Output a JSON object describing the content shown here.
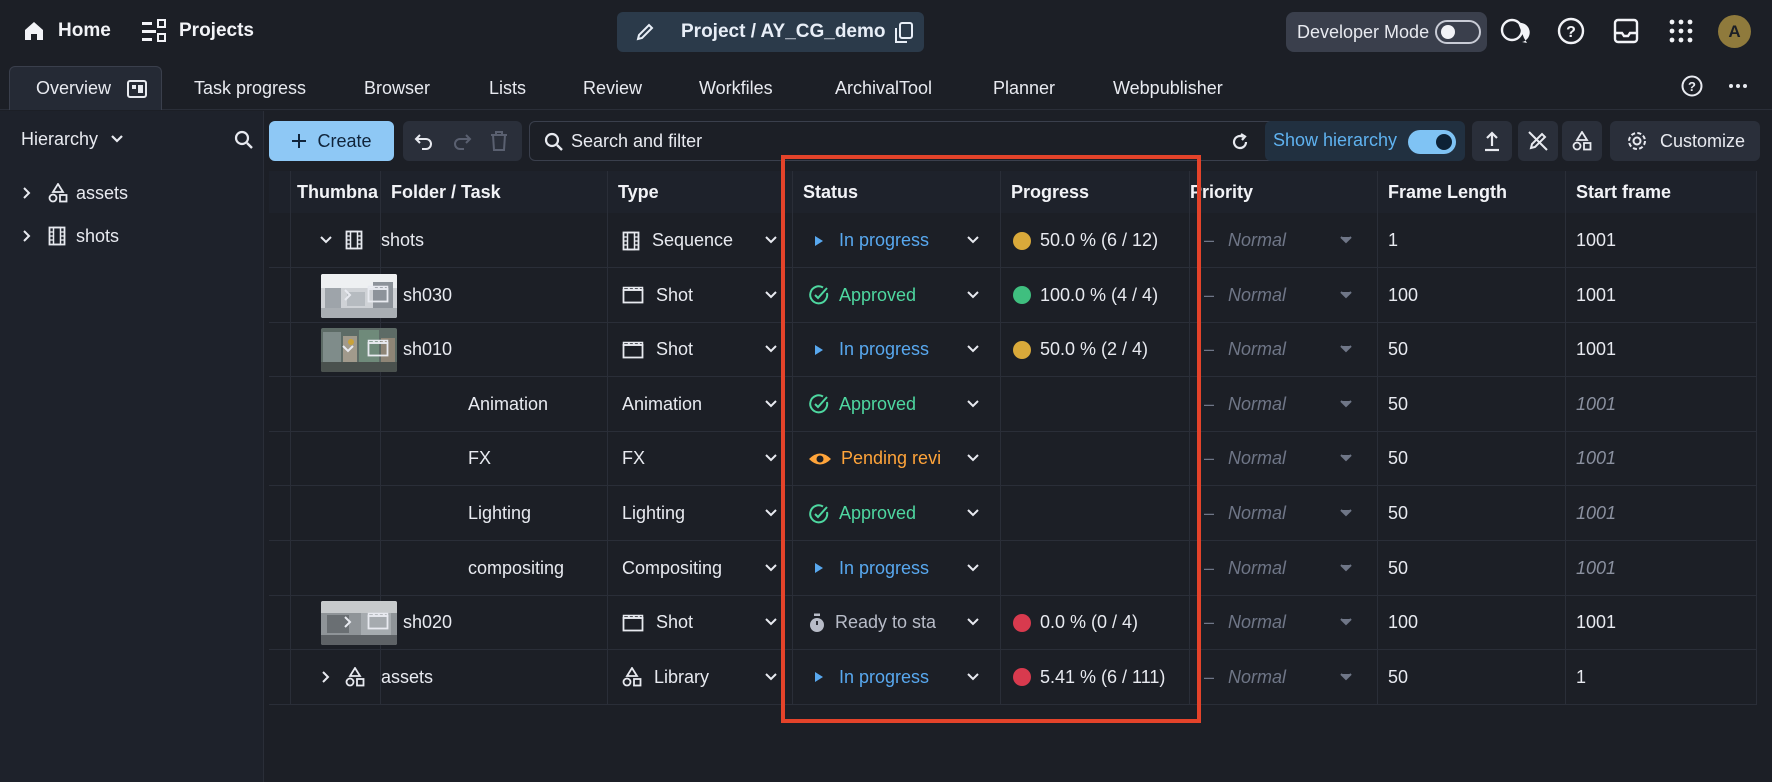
{
  "topbar": {
    "home_label": "Home",
    "projects_label": "Projects",
    "project_label": "Project / AY_CG_demo",
    "developer_mode_label": "Developer Mode",
    "avatar_initial": "A"
  },
  "tabs": [
    "Overview",
    "Task progress",
    "Browser",
    "Lists",
    "Review",
    "Workfiles",
    "ArchivalTool",
    "Planner",
    "Webpublisher"
  ],
  "sidebar": {
    "header_label": "Hierarchy",
    "items": [
      {
        "label": "assets",
        "icon": "shapes-icon"
      },
      {
        "label": "shots",
        "icon": "film-icon"
      }
    ]
  },
  "toolbar": {
    "create_label": "Create",
    "search_placeholder": "Search and filter",
    "show_hierarchy_label": "Show hierarchy",
    "customize_label": "Customize"
  },
  "table": {
    "columns": [
      "Thumbnail",
      "Folder / Task",
      "Type",
      "Status",
      "Progress",
      "Priority",
      "Frame Length",
      "Start frame"
    ],
    "rows": [
      {
        "name": "shots",
        "type": "Sequence",
        "status": "In progress",
        "progress": "50.0 % (6 / 12)",
        "progress_color": "#d9a93a",
        "priority": "Normal",
        "frame_length": "1",
        "start_frame": "1001"
      },
      {
        "name": "sh030",
        "type": "Shot",
        "status": "Approved",
        "progress": "100.0 % (4 / 4)",
        "progress_color": "#3fbf7f",
        "priority": "Normal",
        "frame_length": "100",
        "start_frame": "1001"
      },
      {
        "name": "sh010",
        "type": "Shot",
        "status": "In progress",
        "progress": "50.0 % (2 / 4)",
        "progress_color": "#d9a93a",
        "priority": "Normal",
        "frame_length": "50",
        "start_frame": "1001"
      },
      {
        "name": "Animation",
        "type": "Animation",
        "status": "Approved",
        "progress": "",
        "priority": "Normal",
        "frame_length": "50",
        "start_frame": "1001"
      },
      {
        "name": "FX",
        "type": "FX",
        "status": "Pending revi",
        "progress": "",
        "priority": "Normal",
        "frame_length": "50",
        "start_frame": "1001"
      },
      {
        "name": "Lighting",
        "type": "Lighting",
        "status": "Approved",
        "progress": "",
        "priority": "Normal",
        "frame_length": "50",
        "start_frame": "1001"
      },
      {
        "name": "compositing",
        "type": "Compositing",
        "status": "In progress",
        "progress": "",
        "priority": "Normal",
        "frame_length": "50",
        "start_frame": "1001"
      },
      {
        "name": "sh020",
        "type": "Shot",
        "status": "Ready to sta",
        "progress": "0.0 % (0 / 4)",
        "progress_color": "#d83a4e",
        "priority": "Normal",
        "frame_length": "100",
        "start_frame": "1001"
      },
      {
        "name": "assets",
        "type": "Library",
        "status": "In progress",
        "progress": "5.41 % (6 / 111)",
        "progress_color": "#d83a4e",
        "priority": "Normal",
        "frame_length": "50",
        "start_frame": "1"
      }
    ]
  },
  "thumbnail_header_text": "Thumbna",
  "colors": {
    "accent": "#8ec8f5",
    "highlight": "#e4432a"
  }
}
